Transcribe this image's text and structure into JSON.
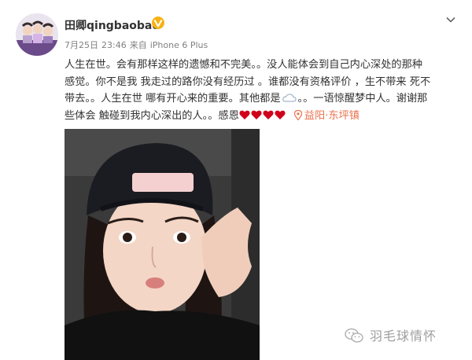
{
  "post": {
    "username": "田卿qingbaobao",
    "date": "7月25日",
    "time": "23:46",
    "source_prefix": "来自",
    "source": "iPhone 6 Plus",
    "lines": [
      "人生在世。会有那样这样的遗憾和不完美。。没人能体会到自己内心深处的那种",
      "感觉。你不是我 我走过的路你没有经历过 。谁都没有资格评价 ，生不带来 死不",
      "带去。。人生在世 哪有开心来的重要。其他都是",
      "。。一语惊醒梦中人。谢谢那",
      "些体会 触碰到我内心深出的人。。感恩",
      ""
    ],
    "location": "益阳·东坪镇"
  },
  "icons": {
    "verified": "vip-badge-icon",
    "menu": "chevron-down-icon",
    "cloud": "cloud-emoji-icon",
    "heart": "heart-emoji-icon",
    "location": "location-pin-icon",
    "wechat": "wechat-logo-icon"
  },
  "colors": {
    "text": "#333333",
    "meta": "#808080",
    "location": "#eb7350",
    "heart": "#d0021b",
    "badge": "#f6b215"
  },
  "watermark": {
    "text": "羽毛球情怀"
  }
}
